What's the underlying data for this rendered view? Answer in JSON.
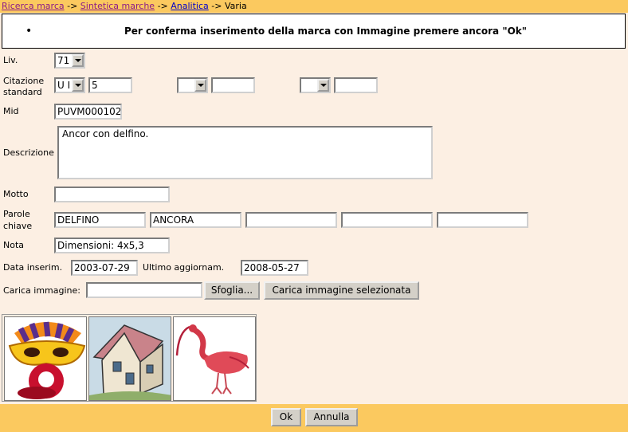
{
  "breadcrumb": {
    "link1": "Ricerca marca",
    "sep": "->",
    "link2": "Sintetica marche",
    "link3": "Analitica",
    "current": "Varia"
  },
  "message": {
    "bullet": "•",
    "text": "Per conferma inserimento della marca con Immagine premere ancora \"Ok\""
  },
  "form": {
    "liv": {
      "label": "Liv.",
      "value": "71"
    },
    "citazione": {
      "label_line1": "Citazione",
      "label_line2": "standard",
      "select1": "U I",
      "input1": "5",
      "select2": "",
      "input2": "",
      "select3": "",
      "input3": ""
    },
    "mid": {
      "label": "Mid",
      "value": "PUVM000102"
    },
    "descrizione": {
      "label": "Descrizione",
      "value": "Ancor con delfino."
    },
    "motto": {
      "label": "Motto",
      "value": ""
    },
    "parole_chiave": {
      "label_line1": "Parole",
      "label_line2": "chiave",
      "values": [
        "DELFINO",
        "ANCORA",
        "",
        "",
        ""
      ]
    },
    "nota": {
      "label": "Nota",
      "value": "Dimensioni: 4x5,3"
    },
    "data_inserim": {
      "label": "Data inserim.",
      "value": "2003-07-29"
    },
    "ultimo_aggiornam": {
      "label": "Ultimo aggiornam.",
      "value": "2008-05-27"
    },
    "carica": {
      "label": "Carica immagine:",
      "value": "",
      "browse_label": "Sfoglia...",
      "upload_label": "Carica immagine selezionata"
    }
  },
  "images": [
    {
      "icon": "carnival-mask-image"
    },
    {
      "icon": "cottage-house-image"
    },
    {
      "icon": "red-ibis-bird-image"
    }
  ],
  "footer": {
    "ok_label": "Ok",
    "annulla_label": "Annulla"
  }
}
